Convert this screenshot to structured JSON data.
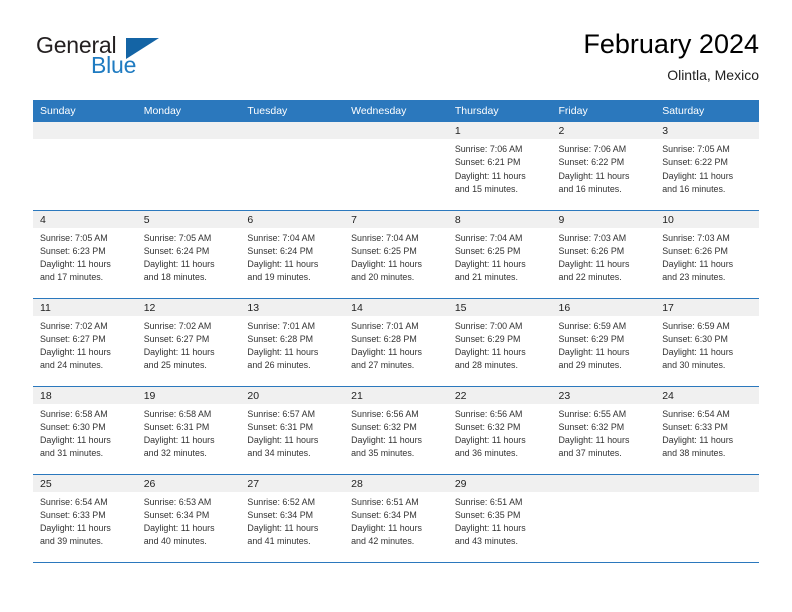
{
  "brand": {
    "name_top": "General",
    "name_bottom": "Blue",
    "accent_color": "#1464a5",
    "text_color": "#231f20"
  },
  "header": {
    "title": "February 2024",
    "location": "Olintla, Mexico"
  },
  "theme": {
    "header_blue": "#2b78bd",
    "daynum_band": "#f0f0f0",
    "body_text": "#333333"
  },
  "calendar": {
    "weekday_headers": [
      "Sunday",
      "Monday",
      "Tuesday",
      "Wednesday",
      "Thursday",
      "Friday",
      "Saturday"
    ],
    "weeks": [
      [
        {
          "day": "",
          "lines": []
        },
        {
          "day": "",
          "lines": []
        },
        {
          "day": "",
          "lines": []
        },
        {
          "day": "",
          "lines": []
        },
        {
          "day": "1",
          "lines": [
            "Sunrise: 7:06 AM",
            "Sunset: 6:21 PM",
            "Daylight: 11 hours",
            "and 15 minutes."
          ]
        },
        {
          "day": "2",
          "lines": [
            "Sunrise: 7:06 AM",
            "Sunset: 6:22 PM",
            "Daylight: 11 hours",
            "and 16 minutes."
          ]
        },
        {
          "day": "3",
          "lines": [
            "Sunrise: 7:05 AM",
            "Sunset: 6:22 PM",
            "Daylight: 11 hours",
            "and 16 minutes."
          ]
        }
      ],
      [
        {
          "day": "4",
          "lines": [
            "Sunrise: 7:05 AM",
            "Sunset: 6:23 PM",
            "Daylight: 11 hours",
            "and 17 minutes."
          ]
        },
        {
          "day": "5",
          "lines": [
            "Sunrise: 7:05 AM",
            "Sunset: 6:24 PM",
            "Daylight: 11 hours",
            "and 18 minutes."
          ]
        },
        {
          "day": "6",
          "lines": [
            "Sunrise: 7:04 AM",
            "Sunset: 6:24 PM",
            "Daylight: 11 hours",
            "and 19 minutes."
          ]
        },
        {
          "day": "7",
          "lines": [
            "Sunrise: 7:04 AM",
            "Sunset: 6:25 PM",
            "Daylight: 11 hours",
            "and 20 minutes."
          ]
        },
        {
          "day": "8",
          "lines": [
            "Sunrise: 7:04 AM",
            "Sunset: 6:25 PM",
            "Daylight: 11 hours",
            "and 21 minutes."
          ]
        },
        {
          "day": "9",
          "lines": [
            "Sunrise: 7:03 AM",
            "Sunset: 6:26 PM",
            "Daylight: 11 hours",
            "and 22 minutes."
          ]
        },
        {
          "day": "10",
          "lines": [
            "Sunrise: 7:03 AM",
            "Sunset: 6:26 PM",
            "Daylight: 11 hours",
            "and 23 minutes."
          ]
        }
      ],
      [
        {
          "day": "11",
          "lines": [
            "Sunrise: 7:02 AM",
            "Sunset: 6:27 PM",
            "Daylight: 11 hours",
            "and 24 minutes."
          ]
        },
        {
          "day": "12",
          "lines": [
            "Sunrise: 7:02 AM",
            "Sunset: 6:27 PM",
            "Daylight: 11 hours",
            "and 25 minutes."
          ]
        },
        {
          "day": "13",
          "lines": [
            "Sunrise: 7:01 AM",
            "Sunset: 6:28 PM",
            "Daylight: 11 hours",
            "and 26 minutes."
          ]
        },
        {
          "day": "14",
          "lines": [
            "Sunrise: 7:01 AM",
            "Sunset: 6:28 PM",
            "Daylight: 11 hours",
            "and 27 minutes."
          ]
        },
        {
          "day": "15",
          "lines": [
            "Sunrise: 7:00 AM",
            "Sunset: 6:29 PM",
            "Daylight: 11 hours",
            "and 28 minutes."
          ]
        },
        {
          "day": "16",
          "lines": [
            "Sunrise: 6:59 AM",
            "Sunset: 6:29 PM",
            "Daylight: 11 hours",
            "and 29 minutes."
          ]
        },
        {
          "day": "17",
          "lines": [
            "Sunrise: 6:59 AM",
            "Sunset: 6:30 PM",
            "Daylight: 11 hours",
            "and 30 minutes."
          ]
        }
      ],
      [
        {
          "day": "18",
          "lines": [
            "Sunrise: 6:58 AM",
            "Sunset: 6:30 PM",
            "Daylight: 11 hours",
            "and 31 minutes."
          ]
        },
        {
          "day": "19",
          "lines": [
            "Sunrise: 6:58 AM",
            "Sunset: 6:31 PM",
            "Daylight: 11 hours",
            "and 32 minutes."
          ]
        },
        {
          "day": "20",
          "lines": [
            "Sunrise: 6:57 AM",
            "Sunset: 6:31 PM",
            "Daylight: 11 hours",
            "and 34 minutes."
          ]
        },
        {
          "day": "21",
          "lines": [
            "Sunrise: 6:56 AM",
            "Sunset: 6:32 PM",
            "Daylight: 11 hours",
            "and 35 minutes."
          ]
        },
        {
          "day": "22",
          "lines": [
            "Sunrise: 6:56 AM",
            "Sunset: 6:32 PM",
            "Daylight: 11 hours",
            "and 36 minutes."
          ]
        },
        {
          "day": "23",
          "lines": [
            "Sunrise: 6:55 AM",
            "Sunset: 6:32 PM",
            "Daylight: 11 hours",
            "and 37 minutes."
          ]
        },
        {
          "day": "24",
          "lines": [
            "Sunrise: 6:54 AM",
            "Sunset: 6:33 PM",
            "Daylight: 11 hours",
            "and 38 minutes."
          ]
        }
      ],
      [
        {
          "day": "25",
          "lines": [
            "Sunrise: 6:54 AM",
            "Sunset: 6:33 PM",
            "Daylight: 11 hours",
            "and 39 minutes."
          ]
        },
        {
          "day": "26",
          "lines": [
            "Sunrise: 6:53 AM",
            "Sunset: 6:34 PM",
            "Daylight: 11 hours",
            "and 40 minutes."
          ]
        },
        {
          "day": "27",
          "lines": [
            "Sunrise: 6:52 AM",
            "Sunset: 6:34 PM",
            "Daylight: 11 hours",
            "and 41 minutes."
          ]
        },
        {
          "day": "28",
          "lines": [
            "Sunrise: 6:51 AM",
            "Sunset: 6:34 PM",
            "Daylight: 11 hours",
            "and 42 minutes."
          ]
        },
        {
          "day": "29",
          "lines": [
            "Sunrise: 6:51 AM",
            "Sunset: 6:35 PM",
            "Daylight: 11 hours",
            "and 43 minutes."
          ]
        },
        {
          "day": "",
          "lines": []
        },
        {
          "day": "",
          "lines": []
        }
      ]
    ]
  }
}
